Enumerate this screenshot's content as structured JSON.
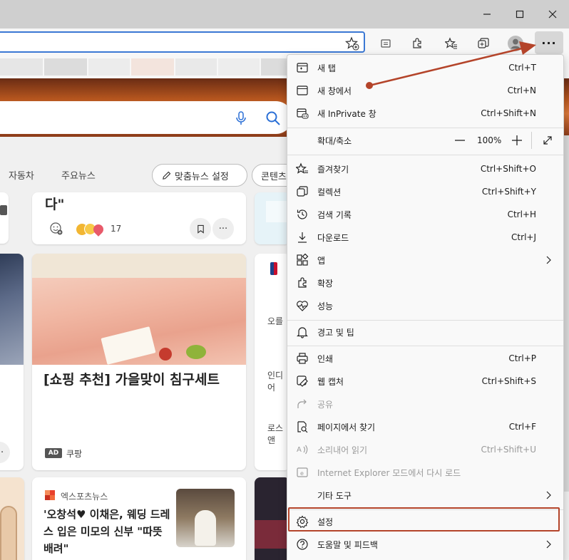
{
  "window": {
    "minimize_label": "—",
    "colors": {
      "titlebar": "#cfcfcf",
      "address_focus": "#3b78d4",
      "annotation": "#b4442a"
    }
  },
  "toolbar": {
    "more_label": "···",
    "icons": [
      "add-favorite-icon",
      "reading-view-icon",
      "extensions-icon",
      "favorites-icon",
      "collections-icon",
      "profile-icon",
      "more-icon"
    ]
  },
  "page": {
    "nav_tabs": [
      "자동차",
      "주요뉴스"
    ],
    "personalize_label": "맞춤뉴스 설정",
    "content_label": "콘텐츠",
    "card1": {
      "title_tail": "다\"",
      "reaction_count": "17"
    },
    "card2": {
      "title": "[쇼핑 추천] 가을맞이 침구세트",
      "ad_badge": "AD",
      "source": "쿠팡"
    },
    "card3": {
      "source": "엑스포츠뉴스",
      "title": "'오창석♥ 이채은, 웨딩 드레스 입은 미모의 신부 \"따뜻 배려\""
    },
    "right_col": {
      "snippet1": "오를",
      "snippet2": "인디어",
      "snippet3": "로스앤"
    },
    "more_label": "···"
  },
  "menu": {
    "items": [
      {
        "id": "new-tab",
        "label": "새 탭",
        "shortcut": "Ctrl+T",
        "icon": "new-tab-icon"
      },
      {
        "id": "new-window",
        "label": "새 창에서",
        "shortcut": "Ctrl+N",
        "icon": "new-window-icon"
      },
      {
        "id": "inprivate",
        "label": "새 InPrivate 창",
        "shortcut": "Ctrl+Shift+N",
        "icon": "inprivate-icon"
      },
      {
        "id": "favorites",
        "label": "즐겨찾기",
        "shortcut": "Ctrl+Shift+O",
        "icon": "favorites-icon"
      },
      {
        "id": "collections",
        "label": "컬렉션",
        "shortcut": "Ctrl+Shift+Y",
        "icon": "collections-icon"
      },
      {
        "id": "history",
        "label": "검색 기록",
        "shortcut": "Ctrl+H",
        "icon": "history-icon"
      },
      {
        "id": "downloads",
        "label": "다운로드",
        "shortcut": "Ctrl+J",
        "icon": "download-icon"
      },
      {
        "id": "apps",
        "label": "앱",
        "shortcut": "",
        "icon": "apps-icon"
      },
      {
        "id": "extensions",
        "label": "확장",
        "shortcut": "",
        "icon": "extensions-icon"
      },
      {
        "id": "performance",
        "label": "성능",
        "shortcut": "",
        "icon": "heartbeat-icon"
      },
      {
        "id": "alerts",
        "label": "경고 및 팁",
        "shortcut": "",
        "icon": "bell-icon"
      },
      {
        "id": "print",
        "label": "인쇄",
        "shortcut": "Ctrl+P",
        "icon": "printer-icon"
      },
      {
        "id": "web-capture",
        "label": "웹 캡처",
        "shortcut": "Ctrl+Shift+S",
        "icon": "web-capture-icon"
      },
      {
        "id": "share",
        "label": "공유",
        "shortcut": "",
        "icon": "share-icon"
      },
      {
        "id": "find",
        "label": "페이지에서 찾기",
        "shortcut": "Ctrl+F",
        "icon": "find-icon"
      },
      {
        "id": "read-aloud",
        "label": "소리내어 읽기",
        "shortcut": "Ctrl+Shift+U",
        "icon": "read-aloud-icon"
      },
      {
        "id": "ie-mode",
        "label": "Internet Explorer 모드에서 다시 로드",
        "shortcut": "",
        "icon": "ie-icon"
      },
      {
        "id": "more-tools",
        "label": "기타 도구",
        "shortcut": "",
        "icon": ""
      },
      {
        "id": "settings",
        "label": "설정",
        "shortcut": "",
        "icon": "gear-icon"
      },
      {
        "id": "help",
        "label": "도움말 및 피드백",
        "shortcut": "",
        "icon": "help-icon"
      }
    ],
    "zoom": {
      "label": "확대/축소",
      "value": "100%",
      "minus": "—",
      "plus": "+"
    }
  }
}
